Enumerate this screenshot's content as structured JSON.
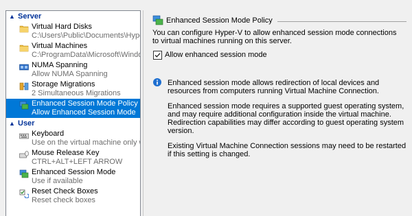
{
  "sidebar": {
    "sections": [
      {
        "label": "Server"
      },
      {
        "label": "User"
      }
    ],
    "server_items": [
      {
        "title": "Virtual Hard Disks",
        "subtitle": "C:\\Users\\Public\\Documents\\Hyper-...",
        "icon": "folder-icon"
      },
      {
        "title": "Virtual Machines",
        "subtitle": "C:\\ProgramData\\Microsoft\\Windo...",
        "icon": "folder-icon"
      },
      {
        "title": "NUMA Spanning",
        "subtitle": "Allow NUMA Spanning",
        "icon": "numa-icon"
      },
      {
        "title": "Storage Migrations",
        "subtitle": "2 Simultaneous Migrations",
        "icon": "storage-migration-icon"
      },
      {
        "title": "Enhanced Session Mode Policy",
        "subtitle": "Allow Enhanced Session Mode",
        "icon": "enhanced-session-icon",
        "selected": true
      }
    ],
    "user_items": [
      {
        "title": "Keyboard",
        "subtitle": "Use on the virtual machine only wh...",
        "icon": "keyboard-icon"
      },
      {
        "title": "Mouse Release Key",
        "subtitle": "CTRL+ALT+LEFT ARROW",
        "icon": "mouse-key-icon"
      },
      {
        "title": "Enhanced Session Mode",
        "subtitle": "Use if available",
        "icon": "enhanced-session-icon"
      },
      {
        "title": "Reset Check Boxes",
        "subtitle": "Reset check boxes",
        "icon": "reset-checkbox-icon"
      }
    ]
  },
  "main": {
    "title": "Enhanced Session Mode Policy",
    "description": "You can configure Hyper-V to allow enhanced session mode connections to virtual machines running on this server.",
    "checkbox": {
      "label": "Allow enhanced session mode",
      "checked": true
    },
    "info": [
      "Enhanced session mode allows redirection of local devices and resources from computers running Virtual Machine Connection.",
      "Enhanced session mode requires a supported guest operating system, and may require additional configuration inside the virtual machine. Redirection capabilities may differ according to guest operating system version.",
      "Existing Virtual Machine Connection sessions may need to be restarted if this setting is changed."
    ]
  },
  "colors": {
    "accent": "#0078d7",
    "section_header": "#003399",
    "subtitle": "#6d6d6d"
  }
}
